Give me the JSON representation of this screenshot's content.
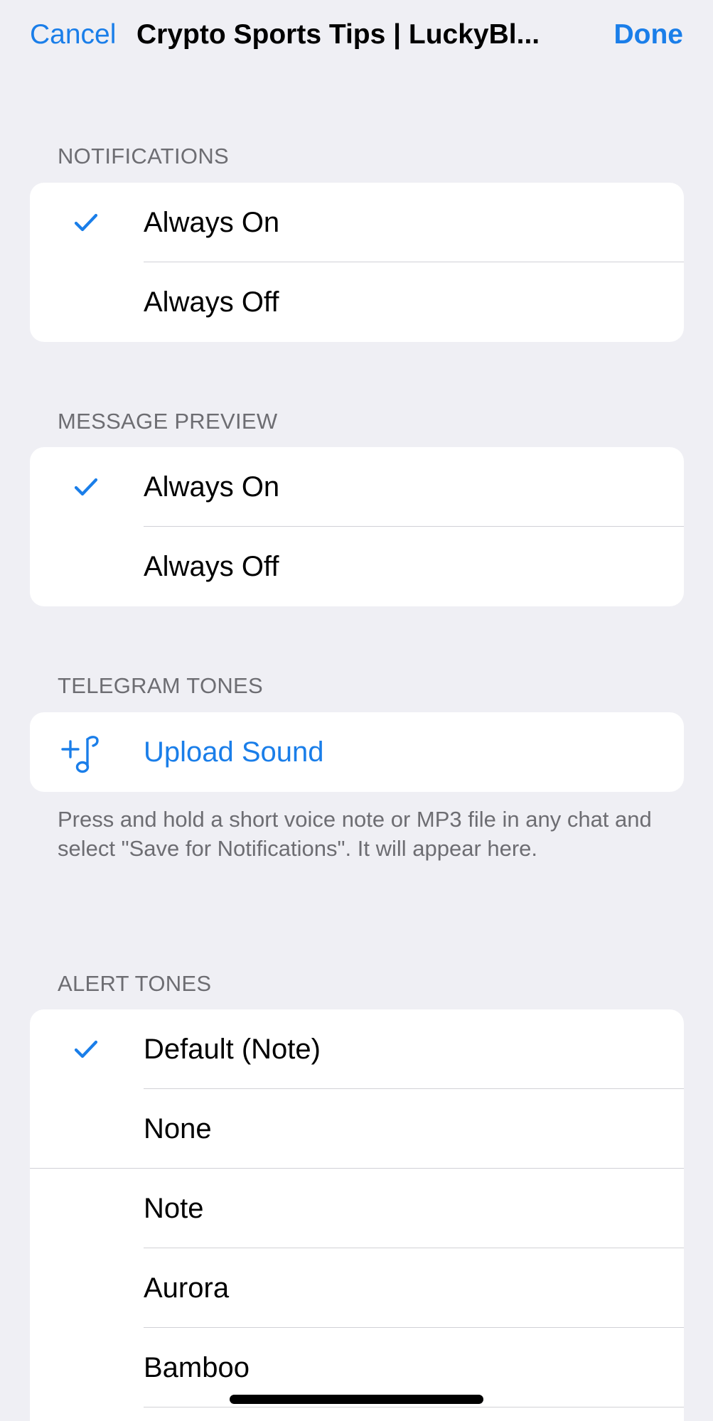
{
  "nav": {
    "cancel_label": "Cancel",
    "title": "Crypto Sports Tips | LuckyBl...",
    "done_label": "Done"
  },
  "notifications": {
    "header": "NOTIFICATIONS",
    "options": [
      {
        "label": "Always On",
        "selected": true
      },
      {
        "label": "Always Off",
        "selected": false
      }
    ]
  },
  "message_preview": {
    "header": "MESSAGE PREVIEW",
    "options": [
      {
        "label": "Always On",
        "selected": true
      },
      {
        "label": "Always Off",
        "selected": false
      }
    ]
  },
  "telegram_tones": {
    "header": "TELEGRAM TONES",
    "upload_label": "Upload Sound",
    "upload_icon": "music-note-plus-icon",
    "footer": "Press and hold a short voice note or MP3 file in any chat and select \"Save for Notifications\". It will appear here."
  },
  "alert_tones": {
    "header": "ALERT TONES",
    "options": [
      {
        "label": "Default (Note)",
        "selected": true
      },
      {
        "label": "None",
        "selected": false
      },
      {
        "label": "Note",
        "selected": false
      },
      {
        "label": "Aurora",
        "selected": false
      },
      {
        "label": "Bamboo",
        "selected": false
      }
    ]
  },
  "colors": {
    "accent": "#1a7ee9",
    "background": "#efeff4",
    "secondary_text": "#6d6d72",
    "separator": "#d1d1d6"
  }
}
